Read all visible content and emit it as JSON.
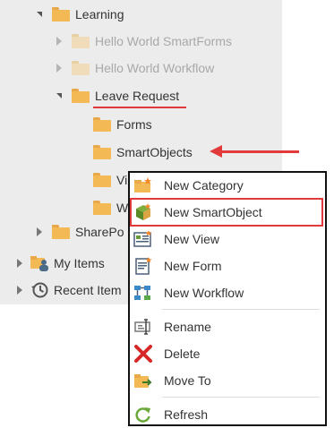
{
  "tree": {
    "items": [
      {
        "label": "Learning",
        "state": "expanded"
      },
      {
        "label": "Hello World SmartForms",
        "state": "collapsed-faded"
      },
      {
        "label": "Hello World Workflow",
        "state": "collapsed-faded"
      },
      {
        "label": "Leave Request",
        "state": "expanded"
      },
      {
        "label": "Forms",
        "state": "leaf"
      },
      {
        "label": "SmartObjects",
        "state": "leaf"
      },
      {
        "label": "Vi",
        "state": "leaf"
      },
      {
        "label": "W",
        "state": "leaf"
      },
      {
        "label": "SharePo",
        "state": "collapsed"
      },
      {
        "label": "My Items",
        "state": "collapsed"
      },
      {
        "label": "Recent Item",
        "state": "collapsed"
      }
    ]
  },
  "context_menu": {
    "items": [
      {
        "label": "New Category",
        "icon": "folder-star-icon"
      },
      {
        "label": "New SmartObject",
        "icon": "smartobject-icon"
      },
      {
        "label": "New View",
        "icon": "view-icon"
      },
      {
        "label": "New Form",
        "icon": "form-icon"
      },
      {
        "label": "New Workflow",
        "icon": "workflow-icon"
      },
      {
        "label": "Rename",
        "icon": "rename-icon"
      },
      {
        "label": "Delete",
        "icon": "delete-icon"
      },
      {
        "label": "Move To",
        "icon": "move-to-icon"
      },
      {
        "label": "Refresh",
        "icon": "refresh-icon"
      }
    ]
  },
  "colors": {
    "highlight": "#e23a3a",
    "folder": "#f3b955",
    "panel_bg": "#ececec"
  }
}
